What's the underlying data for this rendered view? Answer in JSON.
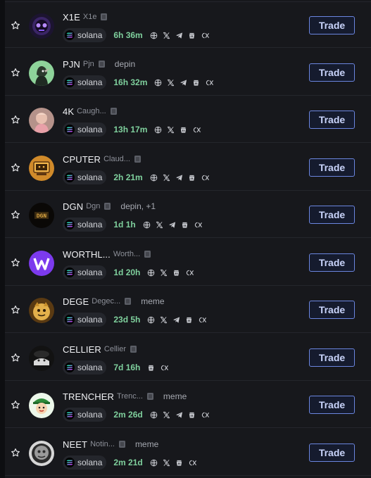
{
  "chain_colors": {
    "solana_top": "#00ffa3",
    "solana_bottom": "#dc1fff"
  },
  "accent": {
    "age": "#7fd09d",
    "trade_border": "#6b86e0"
  },
  "tokens": [
    {
      "ticker": "X1E",
      "name": "X1e",
      "tag": "",
      "chain": "solana",
      "age": "6h 36m",
      "trade_label": "Trade",
      "avatar_icon": "x1e-logo-icon",
      "socials": [
        "globe-icon",
        "x-icon",
        "telegram-icon",
        "audit-icon",
        "dexscreener-icon"
      ]
    },
    {
      "ticker": "PJN",
      "name": "Pjn",
      "tag": "depin",
      "chain": "solana",
      "age": "16h 32m",
      "trade_label": "Trade",
      "avatar_icon": "pjn-logo-icon",
      "socials": [
        "globe-icon",
        "x-icon",
        "telegram-icon",
        "audit-icon",
        "dexscreener-icon"
      ]
    },
    {
      "ticker": "4K",
      "name": "Caugh...",
      "tag": "",
      "chain": "solana",
      "age": "13h 17m",
      "trade_label": "Trade",
      "avatar_icon": "4k-logo-icon",
      "socials": [
        "globe-icon",
        "x-icon",
        "audit-icon",
        "dexscreener-icon"
      ]
    },
    {
      "ticker": "CPUTER",
      "name": "Claud...",
      "tag": "",
      "chain": "solana",
      "age": "2h 21m",
      "trade_label": "Trade",
      "avatar_icon": "cputer-logo-icon",
      "socials": [
        "globe-icon",
        "x-icon",
        "telegram-icon",
        "audit-icon",
        "dexscreener-icon"
      ]
    },
    {
      "ticker": "DGN",
      "name": "Dgn",
      "tag": "depin, +1",
      "chain": "solana",
      "age": "1d 1h",
      "trade_label": "Trade",
      "avatar_icon": "dgn-logo-icon",
      "socials": [
        "globe-icon",
        "x-icon",
        "telegram-icon",
        "audit-icon",
        "dexscreener-icon"
      ]
    },
    {
      "ticker": "WORTHL...",
      "name": "Worth...",
      "tag": "",
      "chain": "solana",
      "age": "1d 20h",
      "trade_label": "Trade",
      "avatar_icon": "worthless-logo-icon",
      "socials": [
        "globe-icon",
        "x-icon",
        "audit-icon",
        "dexscreener-icon"
      ]
    },
    {
      "ticker": "DEGE",
      "name": "Degec...",
      "tag": "meme",
      "chain": "solana",
      "age": "23d 5h",
      "trade_label": "Trade",
      "avatar_icon": "dege-logo-icon",
      "socials": [
        "globe-icon",
        "x-icon",
        "telegram-icon",
        "audit-icon",
        "dexscreener-icon"
      ]
    },
    {
      "ticker": "CELLIER",
      "name": "Cellier",
      "tag": "",
      "chain": "solana",
      "age": "7d 16h",
      "trade_label": "Trade",
      "avatar_icon": "cellier-logo-icon",
      "socials": [
        "audit-icon",
        "dexscreener-icon"
      ]
    },
    {
      "ticker": "TRENCHER",
      "name": "Trenc...",
      "tag": "meme",
      "chain": "solana",
      "age": "2m 26d",
      "trade_label": "Trade",
      "avatar_icon": "trencher-logo-icon",
      "socials": [
        "globe-icon",
        "x-icon",
        "telegram-icon",
        "audit-icon",
        "dexscreener-icon"
      ]
    },
    {
      "ticker": "NEET",
      "name": "Notin...",
      "tag": "meme",
      "chain": "solana",
      "age": "2m 21d",
      "trade_label": "Trade",
      "avatar_icon": "neet-logo-icon",
      "socials": [
        "globe-icon",
        "x-icon",
        "audit-icon",
        "dexscreener-icon"
      ]
    }
  ]
}
